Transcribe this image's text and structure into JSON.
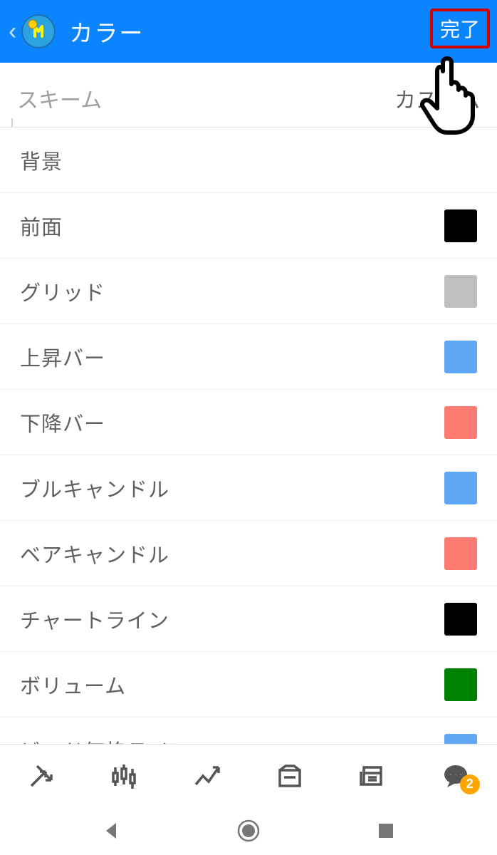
{
  "header": {
    "title": "カラー",
    "done_label": "完了"
  },
  "scheme": {
    "label": "スキーム",
    "value": "カスタム"
  },
  "rows": [
    {
      "label": "背景",
      "color": "#ffffff",
      "white": true
    },
    {
      "label": "前面",
      "color": "#000000"
    },
    {
      "label": "グリッド",
      "color": "#bfbfbf"
    },
    {
      "label": "上昇バー",
      "color": "#5fa8f5"
    },
    {
      "label": "下降バー",
      "color": "#fc7a6f"
    },
    {
      "label": "ブルキャンドル",
      "color": "#5fa8f5"
    },
    {
      "label": "ベアキャンドル",
      "color": "#fc7a6f"
    },
    {
      "label": "チャートライン",
      "color": "#000000"
    },
    {
      "label": "ボリューム",
      "color": "#008000"
    },
    {
      "label": "ビッド価格ライン",
      "color": "#5fa8f5"
    }
  ],
  "tabbar": {
    "badge_count": "2"
  }
}
